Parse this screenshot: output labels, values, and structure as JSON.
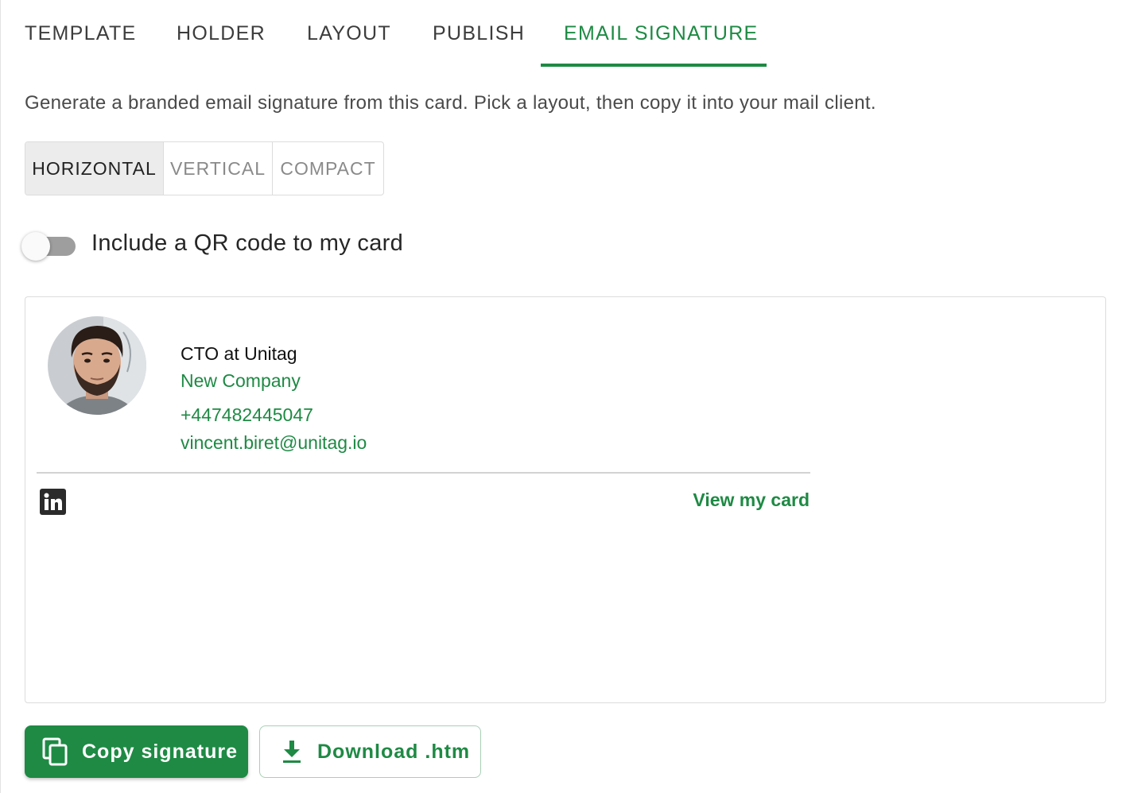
{
  "tabs": [
    {
      "label": "TEMPLATE",
      "active": false
    },
    {
      "label": "HOLDER",
      "active": false
    },
    {
      "label": "LAYOUT",
      "active": false
    },
    {
      "label": "PUBLISH",
      "active": false
    },
    {
      "label": "EMAIL SIGNATURE",
      "active": true
    }
  ],
  "intro_text": "Generate a branded email signature from this card. Pick a layout, then copy it into your mail client.",
  "layout_options": [
    {
      "label": "HORIZONTAL",
      "selected": true
    },
    {
      "label": "VERTICAL",
      "selected": false
    },
    {
      "label": "COMPACT",
      "selected": false
    }
  ],
  "qr_toggle": {
    "label": "Include a QR code to my card",
    "on": false
  },
  "signature": {
    "title": "CTO at Unitag",
    "company": "New Company",
    "phone": "+447482445047",
    "email": "vincent.biret@unitag.io",
    "social_icon": "linkedin-icon",
    "view_card_label": "View my card"
  },
  "actions": {
    "copy_label": "Copy signature",
    "download_label": "Download .htm"
  },
  "colors": {
    "accent": "#1e8a44",
    "tab_text": "#3c3c3c",
    "segment_selected_bg": "#ececec"
  }
}
